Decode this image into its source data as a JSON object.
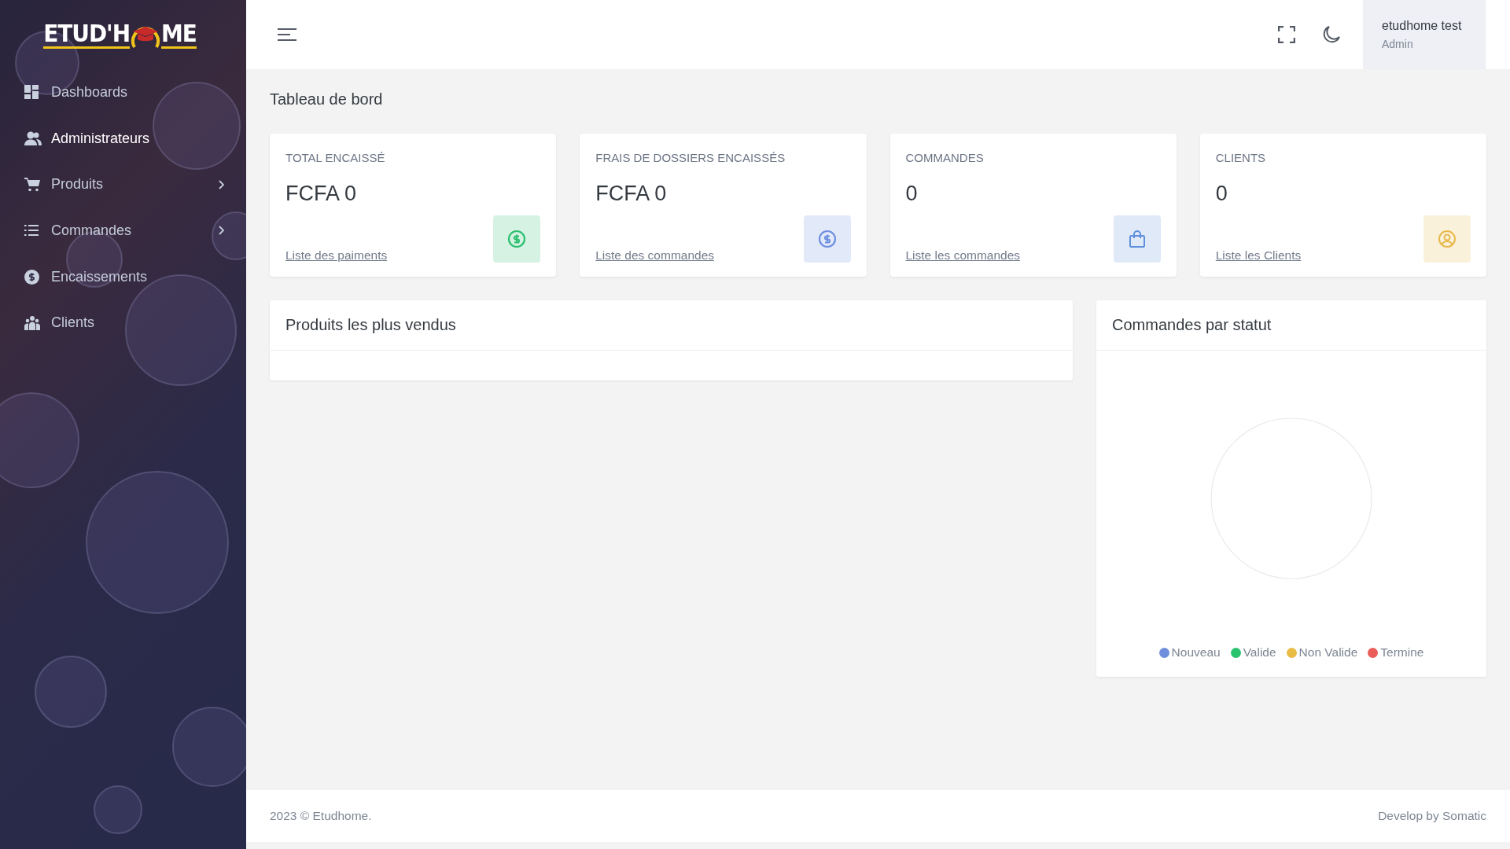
{
  "sidebar": {
    "logo": {
      "left": "ETUD'H",
      "right": "ME"
    },
    "items": [
      {
        "label": "Dashboards",
        "hovered": false,
        "has_submenu": false
      },
      {
        "label": "Administrateurs",
        "hovered": true,
        "has_submenu": false
      },
      {
        "label": "Produits",
        "hovered": false,
        "has_submenu": true
      },
      {
        "label": "Commandes",
        "hovered": false,
        "has_submenu": true
      },
      {
        "label": "Encaissements",
        "hovered": false,
        "has_submenu": false
      },
      {
        "label": "Clients",
        "hovered": false,
        "has_submenu": false
      }
    ]
  },
  "header": {
    "user_name": "etudhome test",
    "user_role": "Admin"
  },
  "page_title": "Tableau de bord",
  "stats": [
    {
      "label": "TOTAL ENCAISSÉ",
      "value": "FCFA 0",
      "link": "Liste des paiments",
      "color": "#2bbf6f"
    },
    {
      "label": "FRAIS DE DOSSIERS ENCAISSÉS",
      "value": "FCFA 0",
      "link": "Liste des commandes",
      "color": "#6f8fe0"
    },
    {
      "label": "COMMANDES",
      "value": "0",
      "link": "Liste les commandes",
      "color": "#5f8fdc"
    },
    {
      "label": "CLIENTS",
      "value": "0",
      "link": "Liste les Clients",
      "color": "#e8b84a"
    }
  ],
  "top_products": {
    "title": "Produits les plus vendus"
  },
  "orders_by_status": {
    "title": "Commandes par statut",
    "legend": [
      {
        "label": "Nouveau",
        "color": "#6f8fdc"
      },
      {
        "label": "Valide",
        "color": "#2ac46f"
      },
      {
        "label": "Non Valide",
        "color": "#e9bd45"
      },
      {
        "label": "Termine",
        "color": "#ea5d58"
      }
    ]
  },
  "footer": {
    "left": "2023 © Etudhome.",
    "right": "Develop by Somatic"
  }
}
